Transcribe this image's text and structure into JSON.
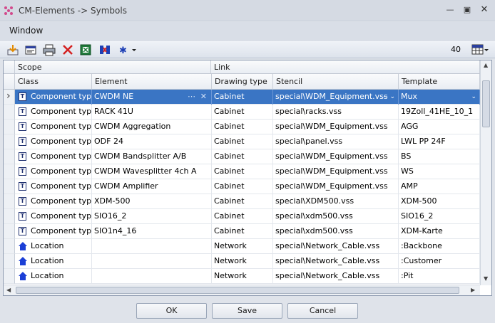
{
  "window": {
    "title": "CM-Elements -> Symbols"
  },
  "menu": {
    "window_label": "Window"
  },
  "toolbar": {
    "count": "40"
  },
  "grid": {
    "group_headers": [
      "Scope",
      "Link"
    ],
    "column_headers": [
      "Class",
      "Element",
      "Drawing type",
      "Stencil",
      "Template"
    ],
    "rows": [
      {
        "class": "Component type",
        "element": "CWDM NE",
        "drawing_type": "Cabinet",
        "stencil": "special\\WDM_Equipment.vss",
        "template": "Mux"
      },
      {
        "class": "Component type",
        "element": "RACK 41U",
        "drawing_type": "Cabinet",
        "stencil": "special\\racks.vss",
        "template": "19Zoll_41HE_10_1"
      },
      {
        "class": "Component type",
        "element": "CWDM Aggregation",
        "drawing_type": "Cabinet",
        "stencil": "special\\WDM_Equipment.vss",
        "template": "AGG"
      },
      {
        "class": "Component type",
        "element": "ODF 24",
        "drawing_type": "Cabinet",
        "stencil": "special\\panel.vss",
        "template": "LWL PP 24F"
      },
      {
        "class": "Component type",
        "element": "CWDM Bandsplitter A/B",
        "drawing_type": "Cabinet",
        "stencil": "special\\WDM_Equipment.vss",
        "template": "BS"
      },
      {
        "class": "Component type",
        "element": "CWDM Wavesplitter 4ch A",
        "drawing_type": "Cabinet",
        "stencil": "special\\WDM_Equipment.vss",
        "template": "WS"
      },
      {
        "class": "Component type",
        "element": "CWDM Amplifier",
        "drawing_type": "Cabinet",
        "stencil": "special\\WDM_Equipment.vss",
        "template": "AMP"
      },
      {
        "class": "Component type",
        "element": "XDM-500",
        "drawing_type": "Cabinet",
        "stencil": "special\\XDM500.vss",
        "template": "XDM-500"
      },
      {
        "class": "Component type",
        "element": "SIO16_2",
        "drawing_type": "Cabinet",
        "stencil": "special\\xdm500.vss",
        "template": "SIO16_2"
      },
      {
        "class": "Component type",
        "element": "SIO1n4_16",
        "drawing_type": "Cabinet",
        "stencil": "special\\xdm500.vss",
        "template": "XDM-Karte"
      },
      {
        "class": "Location",
        "element": "",
        "drawing_type": "Network",
        "stencil": "special\\Network_Cable.vss",
        "template": ":Backbone"
      },
      {
        "class": "Location",
        "element": "",
        "drawing_type": "Network",
        "stencil": "special\\Network_Cable.vss",
        "template": ":Customer"
      },
      {
        "class": "Location",
        "element": "",
        "drawing_type": "Network",
        "stencil": "special\\Network_Cable.vss",
        "template": ":Pit"
      }
    ]
  },
  "footer": {
    "ok_label": "OK",
    "save_label": "Save",
    "cancel_label": "Cancel"
  },
  "colors": {
    "selection": "#3a75c4",
    "location_icon": "#1b3fd6",
    "delete_icon": "#d42020"
  }
}
